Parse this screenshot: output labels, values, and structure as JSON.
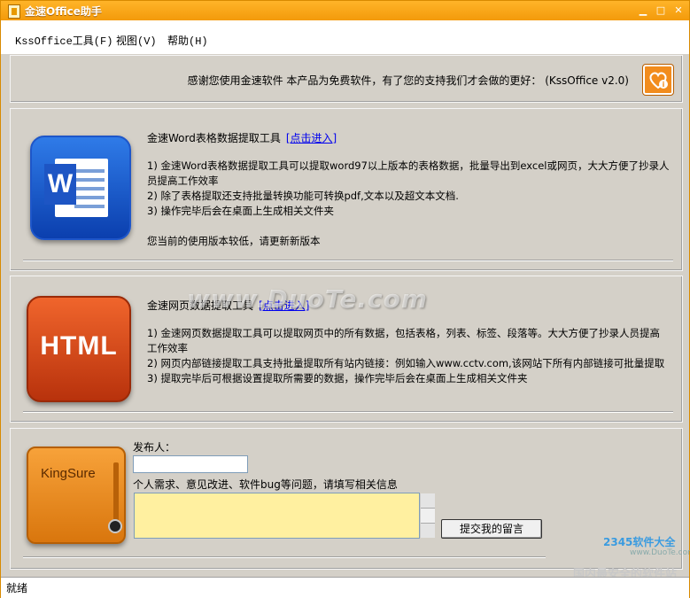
{
  "window": {
    "title": "金速Office助手"
  },
  "menu": {
    "items": [
      "KssOffice工具(F)",
      "视图(V)",
      "帮助(H)"
    ]
  },
  "thanks": {
    "text": "感谢您使用金速软件 本产品为免费软件，有了您的支持我们才会做的更好：  (KssOffice v2.0)"
  },
  "word_tool": {
    "title": "金速Word表格数据提取工具",
    "link": "[点击进入]",
    "desc": [
      "1) 金速Word表格数据提取工具可以提取word97以上版本的表格数据，批量导出到excel或网页，大大方便了抄录人员提高工作效率",
      "2) 除了表格提取还支持批量转换功能可转换pdf,文本以及超文本文档.",
      "3) 操作完毕后会在桌面上生成相关文件夹"
    ],
    "notice": "您当前的使用版本较低，请更新新版本"
  },
  "html_tool": {
    "icon_text": "HTML",
    "title": "金速网页数据提取工具",
    "link": "[点击进入]",
    "desc": [
      "1) 金速网页数据提取工具可以提取网页中的所有数据，包括表格，列表、标签、段落等。大大方便了抄录人员提高工作效率",
      "2) 网页内部链接提取工具支持批量提取所有站内链接：例如输入www.cctv.com,该网站下所有内部链接可批量提取",
      "3) 提取完毕后可根据设置提取所需要的数据，操作完毕后会在桌面上生成相关文件夹"
    ]
  },
  "feedback": {
    "icon_text": "KingSure",
    "publisher_label": "发布人：",
    "publisher_value": "",
    "message_label": "个人需求、意见改进、软件bug等问题，请填写相关信息",
    "message_value": "",
    "submit_label": "提交我的留言"
  },
  "status": {
    "text": "就绪"
  },
  "watermark": {
    "text": "www.DuoTe.com"
  },
  "corner": {
    "brand": "2345软件大全",
    "url": "www.DuoTe.com",
    "slogan": "国内最安全的软件站"
  },
  "colors": {
    "title_orange": "#f7a21b",
    "panel_gray": "#d4d0c8",
    "note_yellow": "#fff0a0",
    "link_blue": "#0000ee"
  }
}
